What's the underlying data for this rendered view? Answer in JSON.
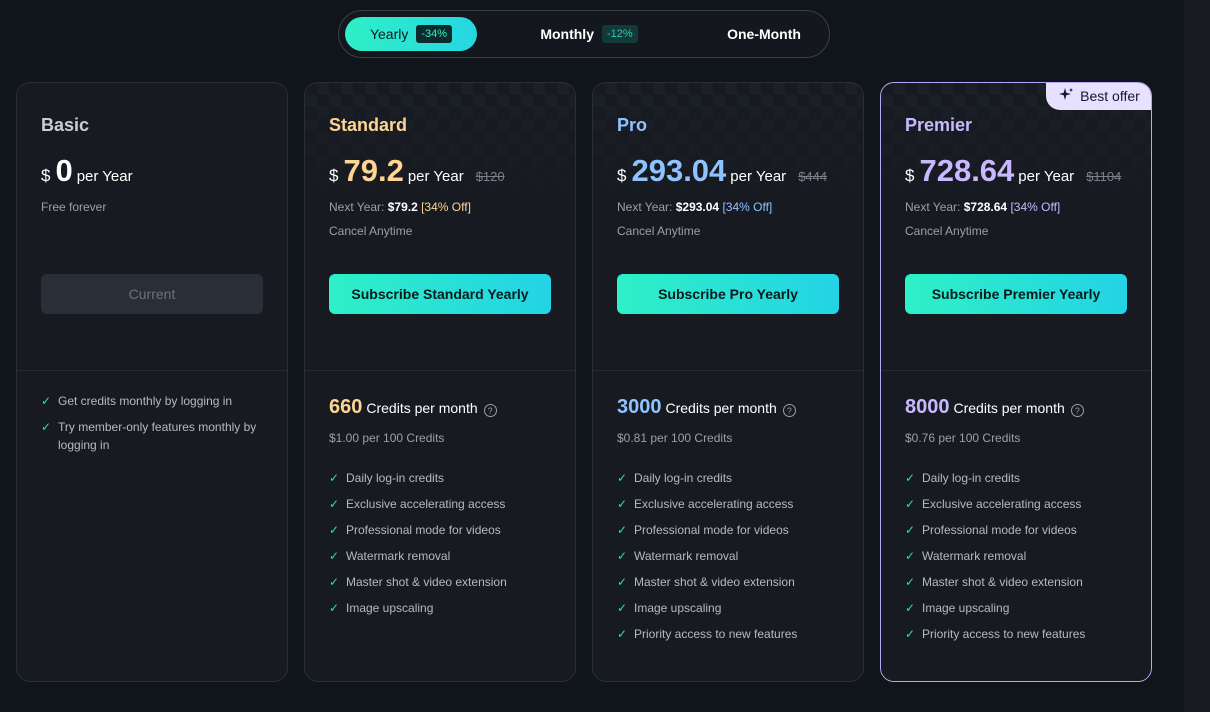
{
  "billing_toggle": {
    "yearly": {
      "label": "Yearly",
      "discount": "-34%"
    },
    "monthly": {
      "label": "Monthly",
      "discount": "-12%"
    },
    "one_month": {
      "label": "One-Month"
    }
  },
  "plans": {
    "basic": {
      "name": "Basic",
      "currency": "$",
      "price": "0",
      "period": "per Year",
      "note": "Free forever",
      "button": "Current",
      "features": [
        "Get credits monthly by logging in",
        "Try member-only features monthly by logging in"
      ]
    },
    "standard": {
      "name": "Standard",
      "currency": "$",
      "price": "79.2",
      "period": "per Year",
      "old_price": "$120",
      "next_year_label": "Next Year:",
      "next_year_price": "$79.2",
      "next_year_off": "[34% Off]",
      "cancel": "Cancel Anytime",
      "button": "Subscribe Standard Yearly",
      "credits": "660",
      "credits_unit": "Credits per month",
      "rate": "$1.00 per 100 Credits",
      "features": [
        "Daily log-in credits",
        "Exclusive accelerating access",
        "Professional mode for videos",
        "Watermark removal",
        "Master shot & video extension",
        "Image upscaling"
      ]
    },
    "pro": {
      "name": "Pro",
      "currency": "$",
      "price": "293.04",
      "period": "per Year",
      "old_price": "$444",
      "next_year_label": "Next Year:",
      "next_year_price": "$293.04",
      "next_year_off": "[34% Off]",
      "cancel": "Cancel Anytime",
      "button": "Subscribe Pro Yearly",
      "credits": "3000",
      "credits_unit": "Credits per month",
      "rate": "$0.81 per 100 Credits",
      "features": [
        "Daily log-in credits",
        "Exclusive accelerating access",
        "Professional mode for videos",
        "Watermark removal",
        "Master shot & video extension",
        "Image upscaling",
        "Priority access to new features"
      ]
    },
    "premier": {
      "name": "Premier",
      "badge": "Best offer",
      "currency": "$",
      "price": "728.64",
      "period": "per Year",
      "old_price": "$1104",
      "next_year_label": "Next Year:",
      "next_year_price": "$728.64",
      "next_year_off": "[34% Off]",
      "cancel": "Cancel Anytime",
      "button": "Subscribe Premier Yearly",
      "credits": "8000",
      "credits_unit": "Credits per month",
      "rate": "$0.76 per 100 Credits",
      "features": [
        "Daily log-in credits",
        "Exclusive accelerating access",
        "Professional mode for videos",
        "Watermark removal",
        "Master shot & video extension",
        "Image upscaling",
        "Priority access to new features"
      ]
    }
  },
  "icons": {
    "check": "check-icon",
    "help": "help-icon",
    "badge": "sparkle-icon"
  },
  "colors": {
    "accent_gradient_start": "#2ef0c6",
    "accent_gradient_end": "#23d3e5",
    "standard": "#ffd493",
    "pro": "#8fc3ff",
    "premier": "#c9b8ff"
  }
}
